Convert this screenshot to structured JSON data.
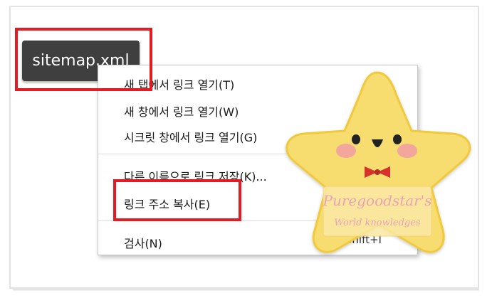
{
  "button": {
    "label": "sitemap.xml"
  },
  "menu": {
    "items": [
      {
        "label": "새 탭에서 링크 열기(T)"
      },
      {
        "label": "새 창에서 링크 열기(W)"
      },
      {
        "label": "시크릿 창에서 링크 열기(G)"
      },
      {
        "label": "다른 이름으로 링크 저장(K)..."
      },
      {
        "label": "링크 주소 복사(E)"
      },
      {
        "label": "검사(N)"
      }
    ],
    "inspect_shortcut": "Ctrl+Shift+I"
  },
  "watermark": {
    "line1": "Puregoodstar's",
    "line2": "World knowledges"
  },
  "colors": {
    "highlight": "#e31b23",
    "button_bg": "#3f3f3f",
    "star_fill": "#f7dc6f",
    "star_stroke": "#f0c93c"
  }
}
